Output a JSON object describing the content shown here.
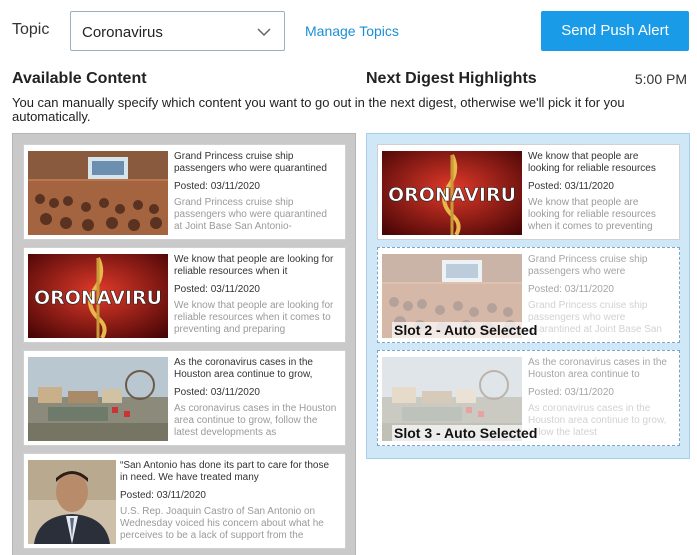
{
  "header": {
    "topic_label": "Topic",
    "topic_value": "Coronavirus",
    "manage_link": "Manage Topics",
    "push_button": "Send Push Alert"
  },
  "sections": {
    "available_title": "Available Content",
    "next_title": "Next Digest Highlights",
    "time": "5:00 PM",
    "description": "You can manually specify which content you want to go out in the next digest, otherwise we'll pick it for you automatically."
  },
  "available": [
    {
      "image": "briefing-room-photo",
      "title": "Grand Princess cruise ship passengers who were quarantined",
      "posted": "Posted: 03/11/2020",
      "body": "Grand Princess cruise ship passengers who were quarantined at Joint Base San Antonio-"
    },
    {
      "image": "coronavirus-graphic",
      "title": "We know that people are looking for reliable resources when it",
      "posted": "Posted: 03/11/2020",
      "body": "We know that people are looking for reliable resources when it comes to preventing and preparing"
    },
    {
      "image": "carnival-aerial-photo",
      "title": "As the coronavirus cases in the Houston area continue to grow,",
      "posted": "Posted: 03/11/2020",
      "body": "As coronavirus cases in the Houston area continue to grow, follow the latest developments as"
    },
    {
      "image": "politician-portrait",
      "title": "“San Antonio has done its part to care for those in need. We have treated many",
      "posted": "Posted: 03/11/2020",
      "body": "U.S. Rep. Joaquin Castro of San Antonio on Wednesday voiced his concern about what he perceives to be a lack of support from the"
    }
  ],
  "digest": [
    {
      "image": "coronavirus-graphic",
      "title": "We know that people are looking for reliable resources",
      "posted": "Posted: 03/11/2020",
      "body": "We know that people are looking for reliable resources when it comes to preventing",
      "slot_label": ""
    },
    {
      "image": "briefing-room-photo",
      "title": "Grand Princess cruise ship passengers who were",
      "posted": "Posted: 03/11/2020",
      "body": "Grand Princess cruise ship passengers who were quarantined at Joint Base San",
      "slot_label": "Slot 2 - Auto Selected"
    },
    {
      "image": "carnival-aerial-photo",
      "title": "As the coronavirus cases in the Houston area continue to",
      "posted": "Posted: 03/11/2020",
      "body": "As coronavirus cases in the Houston area continue to grow, follow the latest",
      "slot_label": "Slot 3 - Auto Selected"
    }
  ],
  "colors": {
    "accent": "#1a9be8",
    "link": "#1a8fd6",
    "digest_panel": "#cfe7f7",
    "available_panel": "#c9c9c9"
  }
}
